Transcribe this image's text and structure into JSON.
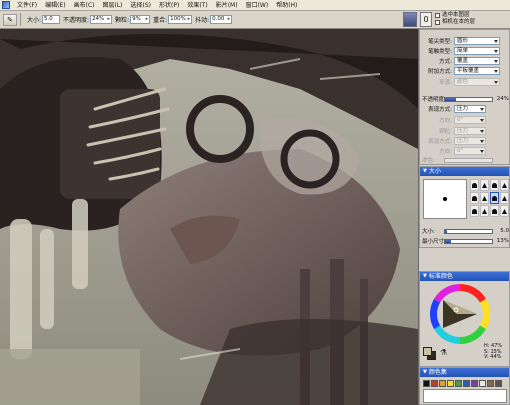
{
  "menu": {
    "items": [
      "文件(F)",
      "编辑(E)",
      "画布(C)",
      "图层(L)",
      "选择(S)",
      "形状(P)",
      "效果(T)",
      "影片(M)",
      "窗口(W)",
      "帮助(H)"
    ]
  },
  "toolbar": {
    "size_label": "大小:",
    "size_value": "5.0",
    "opacity_label": "不透明度:",
    "opacity_value": "24%",
    "grain_label": "颗粒:",
    "grain_value": "9%",
    "resat_label": "重合:",
    "resat_value": "100%",
    "bleed_label": "抖动:",
    "bleed_value": "0.00",
    "check1": "选中本图层",
    "check2": "相机在本的层"
  },
  "brush_panel": {
    "title": "笔触控制",
    "rows": [
      {
        "label": "笔尖类型:",
        "value": "圆形",
        "dim": false
      },
      {
        "label": "笔触类型:",
        "value": "简单",
        "dim": false
      },
      {
        "label": "方式:",
        "value": "覆盖",
        "dim": false
      },
      {
        "label": "附加方式:",
        "value": "平板覆盖",
        "dim": false
      },
      {
        "label": "来源:",
        "value": "颜色",
        "dim": true
      }
    ],
    "opacity_label": "不透明度:",
    "opacity_value": "24%",
    "opacity_level": 0.24,
    "expression_label": "表现方式:",
    "expression_value": "压力",
    "dim_rows": [
      {
        "label": "方向:",
        "value": "0°"
      },
      {
        "label": "颗粒:",
        "value": "压力"
      },
      {
        "label": "表现方式:",
        "value": "压力"
      },
      {
        "label": "方向:",
        "value": "0°"
      },
      {
        "label": "渗色:",
        "value": ""
      }
    ]
  },
  "size_panel": {
    "title": "大小",
    "size_label": "大小:",
    "size_value": "5.0",
    "size_level": 0.05,
    "min_label": "最小尺寸:",
    "min_value": "13%",
    "min_level": 0.13
  },
  "color_panel": {
    "title": "标准颜色",
    "h": "H: 47%",
    "s": "S: 15%",
    "v": "V: 44%",
    "main_color": "#c7c1a6",
    "alt_color": "#2c2520"
  },
  "set_panel": {
    "title": "颜色集",
    "swatches": [
      "#111111",
      "#c83a2a",
      "#e2a020",
      "#f0e030",
      "#4aa040",
      "#2a5fc0",
      "#7a3fa8",
      "#e8e8e8",
      "#8a6a40",
      "#555555"
    ]
  },
  "icons": {
    "dropper": "dropper-icon",
    "brush": "brush-icon",
    "nib": "nib-icon"
  }
}
